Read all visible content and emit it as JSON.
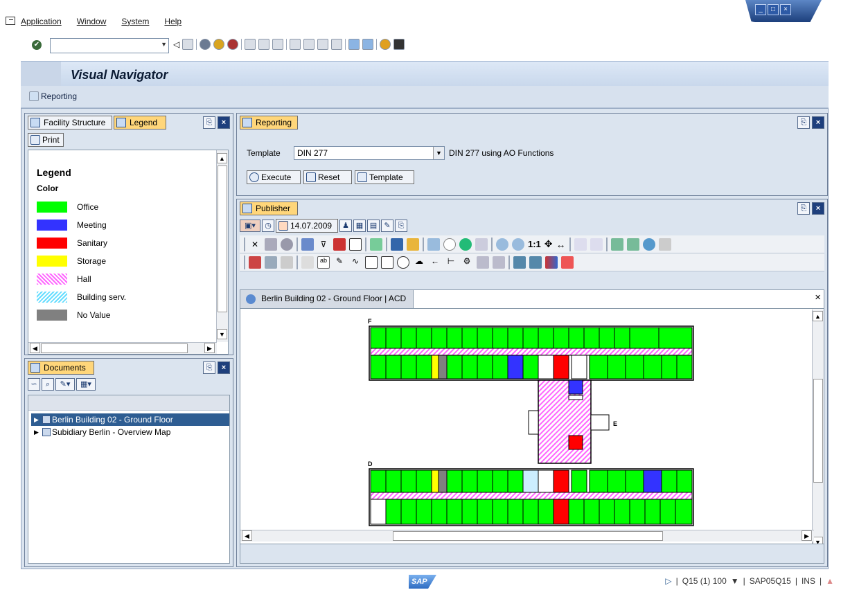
{
  "menu": {
    "items": [
      "Application",
      "Window",
      "System",
      "Help"
    ]
  },
  "window_controls": {
    "minimize": "_",
    "maximize": "□",
    "close": "×"
  },
  "page": {
    "title": "Visual Navigator",
    "app_button": "Reporting"
  },
  "left_top": {
    "tabs": [
      "Facility Structure",
      "Legend"
    ],
    "print_button": "Print",
    "legend": {
      "title": "Legend",
      "subtitle": "Color",
      "items": [
        {
          "label": "Office",
          "color": "#00ff00"
        },
        {
          "label": "Meeting",
          "color": "#3333ff"
        },
        {
          "label": "Sanitary",
          "color": "#ff0000"
        },
        {
          "label": "Storage",
          "color": "#ffff00"
        },
        {
          "label": "Hall",
          "color": "#ff66ff"
        },
        {
          "label": "Building serv.",
          "color": "#66ddff"
        },
        {
          "label": "No Value",
          "color": "#808080"
        }
      ]
    }
  },
  "documents": {
    "tab": "Documents",
    "tree": [
      {
        "label": "Berlin Building 02 - Ground Floor",
        "selected": true
      },
      {
        "label": "Subidiary Berlin - Overview Map",
        "selected": false
      }
    ]
  },
  "reporting": {
    "tab": "Reporting",
    "template_label": "Template",
    "template_value": "DIN 277",
    "template_desc": "DIN 277 using AO Functions",
    "buttons": {
      "execute": "Execute",
      "reset": "Reset",
      "template": "Template"
    }
  },
  "publisher": {
    "tab": "Publisher",
    "date": "14.07.2009",
    "doc_tab": "Berlin Building 02 - Ground Floor | ACD",
    "close": "×",
    "plan_labels": {
      "f": "F",
      "e": "E",
      "d": "D"
    },
    "zoom_ratio": "1:1"
  },
  "status": {
    "logo": "SAP",
    "system": "Q15 (1) 100",
    "server": "SAP05Q15",
    "mode": "INS"
  }
}
